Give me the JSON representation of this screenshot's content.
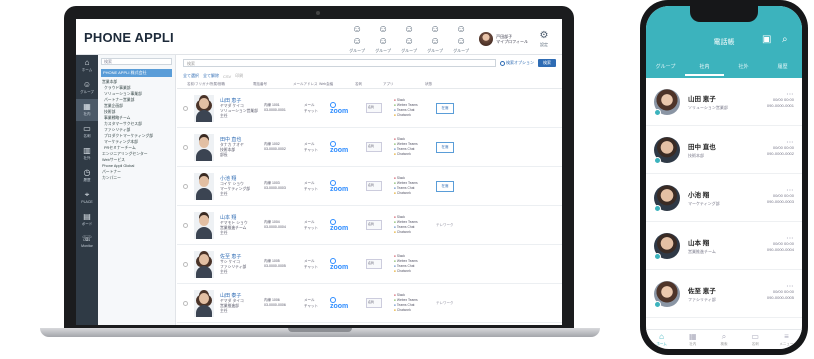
{
  "laptop": {
    "app_title": "PHONE APPLI",
    "header_icons": [
      {
        "icon": "people-group-icon",
        "label": "グループ"
      },
      {
        "icon": "people-group-icon",
        "label": "グループ"
      },
      {
        "icon": "people-group-icon",
        "label": "グループ"
      },
      {
        "icon": "people-group-icon",
        "label": "グループ"
      },
      {
        "icon": "people-group-icon",
        "label": "グループ"
      }
    ],
    "user": {
      "line1": "戸田部子",
      "line2": "マイプロフィール"
    },
    "settings_label": "設定",
    "nav": [
      {
        "icon": "home-icon",
        "label": "ホーム"
      },
      {
        "icon": "people-icon",
        "label": "グループ"
      },
      {
        "icon": "org-icon",
        "label": "社内"
      },
      {
        "icon": "card-icon",
        "label": "名刺"
      },
      {
        "icon": "building-icon",
        "label": "社外"
      },
      {
        "icon": "history-icon",
        "label": "履歴"
      },
      {
        "icon": "place-icon",
        "label": "PLACE"
      },
      {
        "icon": "message-icon",
        "label": "ボード"
      },
      {
        "icon": "phone-icon",
        "label": "Monitor"
      }
    ],
    "tree": {
      "search": "検索",
      "root": "PHONE APPLI 株式会社",
      "items": [
        {
          "label": "営業本部",
          "level": 1
        },
        {
          "label": "クラウド事業部",
          "level": 2
        },
        {
          "label": "ソリューション事業部",
          "level": 2
        },
        {
          "label": "パートナー営業部",
          "level": 2
        },
        {
          "label": "営業企画部",
          "level": 2
        },
        {
          "label": "技術部",
          "level": 2
        },
        {
          "label": "事業戦略チーム",
          "level": 2
        },
        {
          "label": "カスタマーサクセス部",
          "level": 2
        },
        {
          "label": "ファシリティ部",
          "level": 2
        },
        {
          "label": "プロダクトマーケティング部",
          "level": 2
        },
        {
          "label": "マーケティング本部",
          "level": 2
        },
        {
          "label": "PRセミナーチーム",
          "level": 2
        },
        {
          "label": "エンジニアリングセンター",
          "level": 1
        },
        {
          "label": "Webサービス",
          "level": 1
        },
        {
          "label": "Phone Appli Global",
          "level": 1
        },
        {
          "label": "パートナー",
          "level": 1
        },
        {
          "label": "カンパニー",
          "level": 1
        }
      ]
    },
    "main": {
      "search_placeholder": "検索",
      "option_label": "検索オプション",
      "search_button": "検索",
      "toolbar": [
        "全て選択",
        "全て解除",
        "CSV",
        "印刷"
      ],
      "columns": [
        "名前/フリガナ/所属/役職",
        "電話番号",
        "メールアドレス",
        "Web会議",
        "名刺",
        "アプリ",
        "状態"
      ],
      "rows": [
        {
          "name": "山田 恵子",
          "kana": "ヤマダ ケイコ",
          "dept": "ソリューション営業部",
          "role": "主任",
          "tel1": "内線 1001",
          "tel2": "03-0000-0001",
          "mail1": "メール",
          "mail2": "チャット",
          "zoom": "zoom",
          "card": "名刺",
          "apps": [
            "Slack",
            "Webex Teams",
            "Teams Chat",
            "Chatwork"
          ],
          "status": "在席",
          "female": true
        },
        {
          "name": "田中 直也",
          "kana": "タナカ ナオヤ",
          "dept": "技術本部",
          "role": "部長",
          "tel1": "内線 1002",
          "tel2": "03-0000-0002",
          "mail1": "メール",
          "mail2": "チャット",
          "zoom": "zoom",
          "card": "名刺",
          "apps": [
            "Slack",
            "Webex Teams",
            "Teams Chat",
            "Chatwork"
          ],
          "status": "在席",
          "female": false
        },
        {
          "name": "小池 翔",
          "kana": "コイケ ショウ",
          "dept": "マーケティング部",
          "role": "主任",
          "tel1": "内線 1003",
          "tel2": "03-0000-0003",
          "mail1": "メール",
          "mail2": "チャット",
          "zoom": "zoom",
          "card": "名刺",
          "apps": [
            "Slack",
            "Webex Teams",
            "Teams Chat",
            "Chatwork"
          ],
          "status": "在席",
          "female": false
        },
        {
          "name": "山本 翔",
          "kana": "ヤマモト ショウ",
          "dept": "営業推進チーム",
          "role": "主任",
          "tel1": "内線 1004",
          "tel2": "03-0000-0004",
          "mail1": "メール",
          "mail2": "チャット",
          "zoom": "zoom",
          "card": "名刺",
          "apps": [
            "Slack",
            "Webex Teams",
            "Teams Chat",
            "Chatwork"
          ],
          "status": "テレワーク",
          "female": false
        },
        {
          "name": "佐至 恵子",
          "kana": "サシ ケイコ",
          "dept": "ファシリティ部",
          "role": "主任",
          "tel1": "内線 1005",
          "tel2": "03-0000-0005",
          "mail1": "メール",
          "mail2": "チャット",
          "zoom": "zoom",
          "card": "名刺",
          "apps": [
            "Slack",
            "Webex Teams",
            "Teams Chat",
            "Chatwork"
          ],
          "status": "",
          "female": true
        },
        {
          "name": "山田 泰子",
          "kana": "ヤマダ タイコ",
          "dept": "営業推進部",
          "role": "主任",
          "tel1": "内線 1006",
          "tel2": "03-0000-0006",
          "mail1": "メール",
          "mail2": "チャット",
          "zoom": "zoom",
          "card": "名刺",
          "apps": [
            "Slack",
            "Webex Teams",
            "Teams Chat",
            "Chatwork"
          ],
          "status": "テレワーク",
          "female": true
        }
      ]
    }
  },
  "phone": {
    "title": "電話帳",
    "tabs": [
      "グループ",
      "社内",
      "社外",
      "履歴"
    ],
    "contacts": [
      {
        "name": "山田 恵子",
        "dept": "ソリューション営業部",
        "meta1": "00/00 00:00",
        "meta2": "090-0000-0001",
        "female": true
      },
      {
        "name": "田中 直也",
        "dept": "技術本部",
        "meta1": "00/00 00:00",
        "meta2": "090-0000-0002",
        "female": false
      },
      {
        "name": "小池 翔",
        "dept": "マーケティング部",
        "meta1": "00/00 00:00",
        "meta2": "090-0000-0003",
        "female": false
      },
      {
        "name": "山本 翔",
        "dept": "営業推進チーム",
        "meta1": "00/00 00:00",
        "meta2": "090-0000-0004",
        "female": false
      },
      {
        "name": "佐至 恵子",
        "dept": "ファシリティ部",
        "meta1": "00/00 00:00",
        "meta2": "090-0000-0005",
        "female": true
      },
      {
        "name": "山田 泰子",
        "dept": "営業推進部",
        "meta1": "00/00 00:00",
        "meta2": "090-0000-0006",
        "female": true
      }
    ],
    "bottom_nav": [
      {
        "icon": "home-icon",
        "label": "ホーム"
      },
      {
        "icon": "org-icon",
        "label": "社内"
      },
      {
        "icon": "search-icon",
        "label": "検索"
      },
      {
        "icon": "card-icon",
        "label": "名刺"
      },
      {
        "icon": "menu-icon",
        "label": "メニュー"
      }
    ],
    "accent": "#3cb3bd"
  }
}
